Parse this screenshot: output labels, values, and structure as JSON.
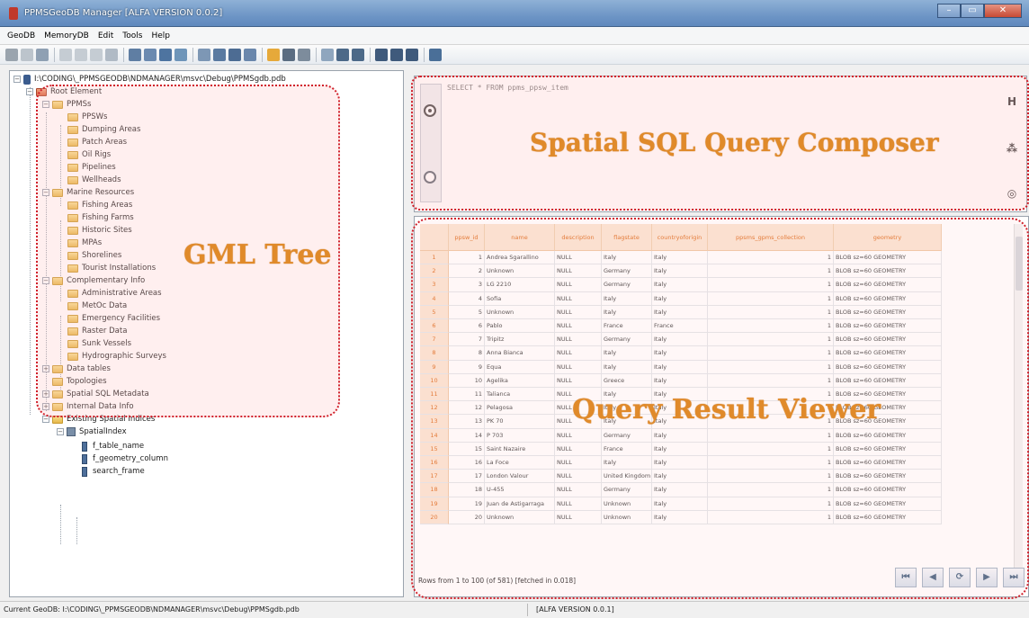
{
  "window": {
    "title": "PPMSGeoDB Manager [ALFA VERSION 0.0.2]"
  },
  "menu": [
    "GeoDB",
    "MemoryDB",
    "Edit",
    "Tools",
    "Help"
  ],
  "tree": {
    "root_path": "I:\\CODING\\_PPMSGEODB\\NDMANAGER\\msvc\\Debug\\PPMSgdb.pdb",
    "root_element": "Root Element",
    "ppms": {
      "label": "PPMSs",
      "children": [
        "PPSWs",
        "Dumping Areas",
        "Patch Areas",
        "Oil Rigs",
        "Pipelines",
        "Wellheads"
      ]
    },
    "marine": {
      "label": "Marine Resources",
      "children": [
        "Fishing Areas",
        "Fishing Farms",
        "Historic Sites",
        "MPAs",
        "Shorelines",
        "Tourist Installations"
      ]
    },
    "complementary": {
      "label": "Complementary Info",
      "children": [
        "Administrative Areas",
        "MetOc Data",
        "Emergency Facilities",
        "Raster Data",
        "Sunk Vessels",
        "Hydrographic Surveys"
      ]
    },
    "other": [
      "Data tables",
      "Topologies",
      "Spatial SQL Metadata",
      "Internal Data Info",
      "Existing Spatial Indices"
    ],
    "spatial_index": {
      "label": "SpatialIndex",
      "columns": [
        "f_table_name",
        "f_geometry_column",
        "search_frame"
      ]
    }
  },
  "overlays": {
    "gml_tree": "GML Tree",
    "composer": "Spatial SQL Query Composer",
    "viewer": "Query Result Viewer"
  },
  "query": {
    "sql": "SELECT * FROM ppms_ppsw_item"
  },
  "grid": {
    "columns": [
      "ppsw_id",
      "name",
      "description",
      "flagstate",
      "countryoforigin",
      "ppsms_gpms_collection",
      "geometry"
    ],
    "rows": [
      [
        "1",
        "1",
        "Andrea Sgarallino",
        "NULL",
        "Italy",
        "Italy",
        "1",
        "BLOB sz=60 GEOMETRY"
      ],
      [
        "2",
        "2",
        "Unknown",
        "NULL",
        "Germany",
        "Italy",
        "1",
        "BLOB sz=60 GEOMETRY"
      ],
      [
        "3",
        "3",
        "LG 2210",
        "NULL",
        "Germany",
        "Italy",
        "1",
        "BLOB sz=60 GEOMETRY"
      ],
      [
        "4",
        "4",
        "Sofia",
        "NULL",
        "Italy",
        "Italy",
        "1",
        "BLOB sz=60 GEOMETRY"
      ],
      [
        "5",
        "5",
        "Unknown",
        "NULL",
        "Italy",
        "Italy",
        "1",
        "BLOB sz=60 GEOMETRY"
      ],
      [
        "6",
        "6",
        "Pablo",
        "NULL",
        "France",
        "France",
        "1",
        "BLOB sz=60 GEOMETRY"
      ],
      [
        "7",
        "7",
        "Tripitz",
        "NULL",
        "Germany",
        "Italy",
        "1",
        "BLOB sz=60 GEOMETRY"
      ],
      [
        "8",
        "8",
        "Anna Bianca",
        "NULL",
        "Italy",
        "Italy",
        "1",
        "BLOB sz=60 GEOMETRY"
      ],
      [
        "9",
        "9",
        "Equa",
        "NULL",
        "Italy",
        "Italy",
        "1",
        "BLOB sz=60 GEOMETRY"
      ],
      [
        "10",
        "10",
        "Agelika",
        "NULL",
        "Greece",
        "Italy",
        "1",
        "BLOB sz=60 GEOMETRY"
      ],
      [
        "11",
        "11",
        "Talianca",
        "NULL",
        "Italy",
        "Italy",
        "1",
        "BLOB sz=60 GEOMETRY"
      ],
      [
        "12",
        "12",
        "Pelagosa",
        "NULL",
        "Italy",
        "Italy",
        "1",
        "BLOB sz=60 GEOMETRY"
      ],
      [
        "13",
        "13",
        "PK 70",
        "NULL",
        "Italy",
        "Italy",
        "1",
        "BLOB sz=60 GEOMETRY"
      ],
      [
        "14",
        "14",
        "P 703",
        "NULL",
        "Germany",
        "Italy",
        "1",
        "BLOB sz=60 GEOMETRY"
      ],
      [
        "15",
        "15",
        "Saint Nazaire",
        "NULL",
        "France",
        "Italy",
        "1",
        "BLOB sz=60 GEOMETRY"
      ],
      [
        "16",
        "16",
        "La Foce",
        "NULL",
        "Italy",
        "Italy",
        "1",
        "BLOB sz=60 GEOMETRY"
      ],
      [
        "17",
        "17",
        "London Valour",
        "NULL",
        "United Kingdom",
        "Italy",
        "1",
        "BLOB sz=60 GEOMETRY"
      ],
      [
        "18",
        "18",
        "U-455",
        "NULL",
        "Germany",
        "Italy",
        "1",
        "BLOB sz=60 GEOMETRY"
      ],
      [
        "19",
        "19",
        "Juan de Astigarraga",
        "NULL",
        "Unknown",
        "Italy",
        "1",
        "BLOB sz=60 GEOMETRY"
      ],
      [
        "20",
        "20",
        "Unknown",
        "NULL",
        "Unknown",
        "Italy",
        "1",
        "BLOB sz=60 GEOMETRY"
      ]
    ],
    "rows_info": "Rows from 1 to 100 (of 581) [fetched in 0.018]"
  },
  "nav": [
    "first-icon",
    "prev-icon",
    "refresh-icon",
    "next-icon",
    "last-icon"
  ],
  "status": {
    "left": "Current GeoDB: I:\\CODING\\_PPMSGEODB\\NDMANAGER\\msvc\\Debug\\PPMSgdb.pdb",
    "right": "[ALFA VERSION 0.0.1]"
  },
  "colors": {
    "accent": "#e08a2a",
    "highlight": "#d0202a",
    "header_bg": "#fbe5d3"
  }
}
